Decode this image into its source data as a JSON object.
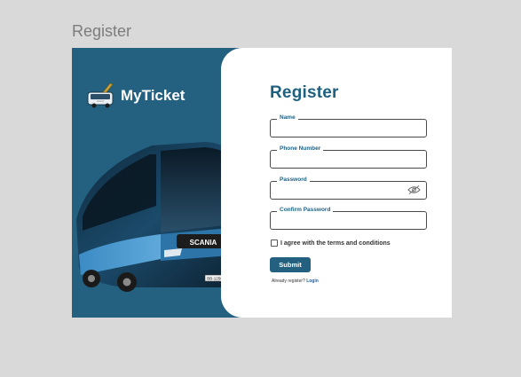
{
  "page_label": "Register",
  "brand": {
    "name": "MyTicket"
  },
  "bus": {
    "brand_text": "SCANIA",
    "plate_text": "BB-1250"
  },
  "form": {
    "title": "Register",
    "fields": [
      {
        "label": "Name",
        "value": "",
        "placeholder": ""
      },
      {
        "label": "Phone Number",
        "value": "",
        "placeholder": ""
      },
      {
        "label": "Password",
        "value": "",
        "placeholder": ""
      },
      {
        "label": "Confirm Password",
        "value": "",
        "placeholder": ""
      }
    ],
    "terms_label": "I agree with the terms and conditions",
    "submit_label": "Submit",
    "already_text": "Already register?",
    "login_link": "Login"
  },
  "colors": {
    "brand_blue": "#24607f",
    "title_blue": "#1f5f80",
    "background": "#d9d9d9",
    "card": "#ffffff"
  },
  "icons": {
    "logo": "bus-logo-icon",
    "password_toggle": "eye-off-icon",
    "checkbox": "checkbox-icon"
  }
}
